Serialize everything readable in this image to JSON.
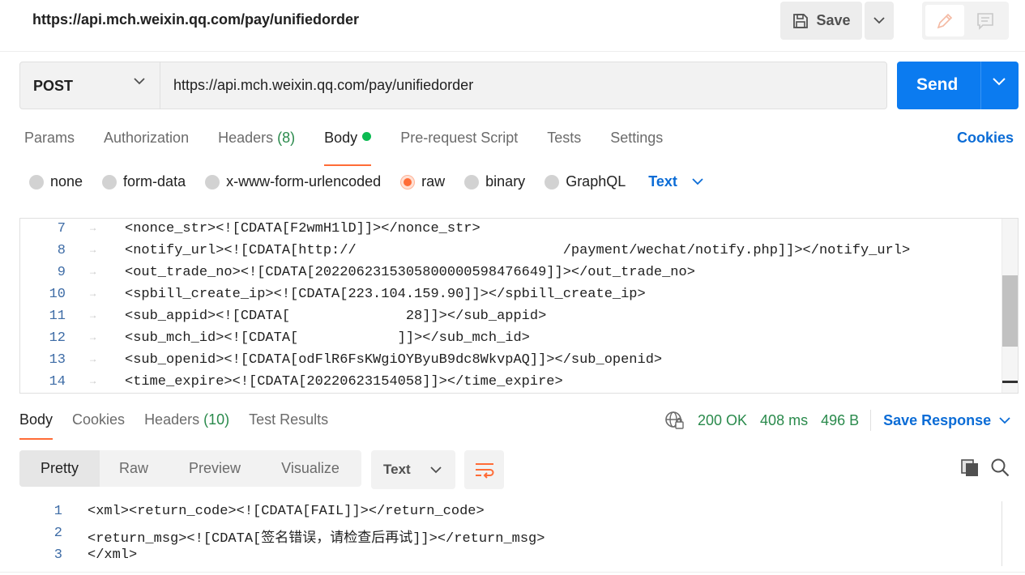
{
  "request": {
    "title": "https://api.mch.weixin.qq.com/pay/unifiedorder",
    "save_label": "Save",
    "method": "POST",
    "url": "https://api.mch.weixin.qq.com/pay/unifiedorder",
    "send_label": "Send"
  },
  "request_tabs": [
    {
      "label": "Params"
    },
    {
      "label": "Authorization"
    },
    {
      "label": "Headers",
      "count": "(8)"
    },
    {
      "label": "Body",
      "active": true
    },
    {
      "label": "Pre-request Script"
    },
    {
      "label": "Tests"
    },
    {
      "label": "Settings"
    }
  ],
  "cookies_label": "Cookies",
  "body_types": [
    {
      "label": "none"
    },
    {
      "label": "form-data"
    },
    {
      "label": "x-www-form-urlencoded"
    },
    {
      "label": "raw",
      "selected": true
    },
    {
      "label": "binary"
    },
    {
      "label": "GraphQL"
    }
  ],
  "body_format": "Text",
  "editor_lines": [
    {
      "num": "7",
      "text": "<nonce_str><![CDATA[F2wmH1lD]]></nonce_str>"
    },
    {
      "num": "8",
      "text": "<notify_url><![CDATA[http://                         /payment/wechat/notify.php]]></notify_url>"
    },
    {
      "num": "9",
      "text": "<out_trade_no><![CDATA[20220623153058000005984766​49]]></out_trade_no>"
    },
    {
      "num": "10",
      "text": "<spbill_create_ip><![CDATA[223.104.159.90]]></spbill_create_ip>"
    },
    {
      "num": "11",
      "text": "<sub_appid><![CDATA[              28]]></sub_appid>"
    },
    {
      "num": "12",
      "text": "<sub_mch_id><![CDATA[            ]]></sub_mch_id>"
    },
    {
      "num": "13",
      "text": "<sub_openid><![CDATA[odFlR6FsKWgiOYByuB9dc8WkvpAQ]]></sub_openid>"
    },
    {
      "num": "14",
      "text": "<time_expire><![CDATA[20220623154058]]></time_expire>"
    }
  ],
  "response_tabs": [
    {
      "label": "Body",
      "active": true
    },
    {
      "label": "Cookies"
    },
    {
      "label": "Headers",
      "count": "(10)"
    },
    {
      "label": "Test Results"
    }
  ],
  "response_meta": {
    "status": "200 OK",
    "time": "408 ms",
    "size": "496 B",
    "save_response_label": "Save Response"
  },
  "view_modes": [
    {
      "label": "Pretty",
      "active": true
    },
    {
      "label": "Raw"
    },
    {
      "label": "Preview"
    },
    {
      "label": "Visualize"
    }
  ],
  "response_format": "Text",
  "response_lines": [
    {
      "num": "1",
      "text": "<xml><return_code><![CDATA[FAIL]]></return_code>"
    },
    {
      "num": "2",
      "text": "<return_msg><![CDATA[签名错误，请检查后再试]]></return_msg>"
    },
    {
      "num": "3",
      "text": "</xml>"
    }
  ],
  "colors": {
    "accent_orange": "#ff6c37",
    "send_blue": "#0b7bf0",
    "link_blue": "#0b6cd6",
    "success_green": "#2a8a4c"
  }
}
